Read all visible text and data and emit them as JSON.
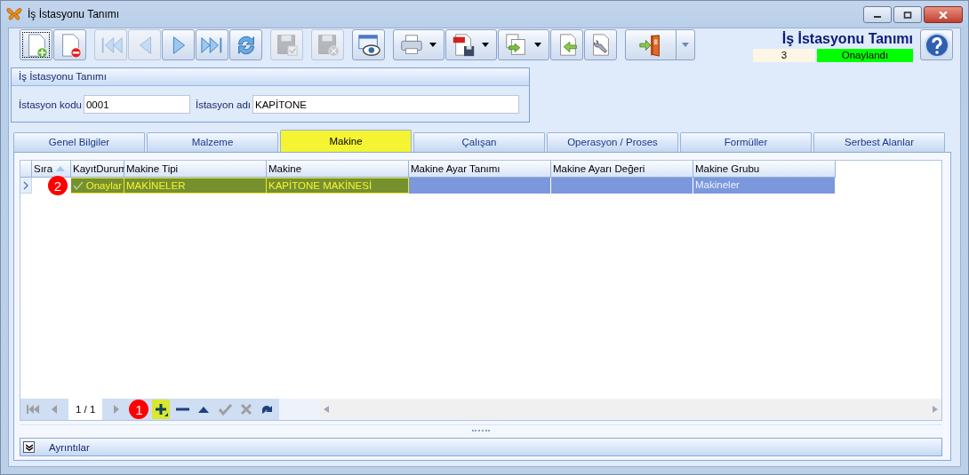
{
  "window": {
    "title": "İş İstasyonu Tanımı"
  },
  "toolbar": [
    {
      "kind": "new",
      "disabled": false,
      "focused": true
    },
    {
      "kind": "delete",
      "disabled": false,
      "focused": false
    },
    {
      "kind": "first",
      "disabled": true,
      "focused": false
    },
    {
      "kind": "prev",
      "disabled": true,
      "focused": false
    },
    {
      "kind": "next",
      "disabled": false,
      "focused": false
    },
    {
      "kind": "last",
      "disabled": false,
      "focused": false
    },
    {
      "kind": "refresh",
      "disabled": false,
      "focused": false
    },
    {
      "kind": "save",
      "disabled": true,
      "focused": false
    },
    {
      "kind": "cancel",
      "disabled": true,
      "focused": false
    },
    {
      "kind": "preview",
      "disabled": false,
      "focused": false
    },
    {
      "kind": "print",
      "disabled": false,
      "focused": false,
      "dropdown": true
    },
    {
      "kind": "pdf",
      "disabled": false,
      "focused": false,
      "dropdown": true
    },
    {
      "kind": "export",
      "disabled": false,
      "focused": false,
      "dropdown": true
    },
    {
      "kind": "import",
      "disabled": false,
      "focused": false
    },
    {
      "kind": "tools",
      "disabled": false,
      "focused": false
    },
    {
      "kind": "exit",
      "disabled": false,
      "focused": false,
      "dropdown": true
    }
  ],
  "header": {
    "title": "İş İstasyonu Tanımı",
    "record_no": "3",
    "status": "Onaylandı"
  },
  "group": {
    "title": "İş İstasyonu Tanımı",
    "fields": [
      {
        "label": "İstasyon kodu",
        "value": "0001"
      },
      {
        "label": "İstasyon adı",
        "value": "KAPİTONE"
      }
    ]
  },
  "tabs": [
    {
      "label": "Genel Bilgiler",
      "selected": false
    },
    {
      "label": "Malzeme",
      "selected": false
    },
    {
      "label": "Makine",
      "selected": true
    },
    {
      "label": "Çalışan",
      "selected": false
    },
    {
      "label": "Operasyon / Proses",
      "selected": false
    },
    {
      "label": "Formüller",
      "selected": false
    },
    {
      "label": "Serbest Alanlar",
      "selected": false
    }
  ],
  "grid": {
    "columns": [
      {
        "label": "Sıra",
        "sorted": true
      },
      {
        "label": "KayıtDurum",
        "sorted": false
      },
      {
        "label": "Makine Tipi",
        "sorted": false
      },
      {
        "label": "Makine",
        "sorted": false
      },
      {
        "label": "Makine Ayar Tanımı",
        "sorted": false
      },
      {
        "label": "Makine Ayarı Değeri",
        "sorted": false
      },
      {
        "label": "Makine Grubu",
        "sorted": false
      }
    ],
    "rows": [
      {
        "selected": true,
        "callout": "2",
        "cells": [
          {
            "kind": "empty"
          },
          {
            "text": "Onaylar",
            "kind": "status",
            "highlight": true
          },
          {
            "text": "MAKİNELER",
            "highlight": true
          },
          {
            "text": "KAPİTONE MAKİNESİ",
            "highlight": true
          },
          {
            "highlight": false
          },
          {
            "highlight": false
          },
          {
            "text": "Makineler",
            "highlight": false
          }
        ]
      }
    ]
  },
  "pager": {
    "page": "1 / 1",
    "callout": "1",
    "buttons": [
      {
        "kind": "first",
        "disabled": true,
        "highlight": false
      },
      {
        "kind": "prev",
        "disabled": true,
        "highlight": false
      },
      {
        "kind": "page"
      },
      {
        "kind": "next",
        "disabled": true,
        "highlight": false
      },
      {
        "kind": "add",
        "disabled": false,
        "highlight": true
      },
      {
        "kind": "remove",
        "disabled": false,
        "highlight": false
      },
      {
        "kind": "up",
        "disabled": false,
        "highlight": false
      },
      {
        "kind": "accept",
        "disabled": true,
        "highlight": false
      },
      {
        "kind": "cancel",
        "disabled": true,
        "highlight": false
      },
      {
        "kind": "redo",
        "disabled": false,
        "highlight": false
      }
    ]
  },
  "details": {
    "label": "Ayrıntılar",
    "expanded": false
  }
}
